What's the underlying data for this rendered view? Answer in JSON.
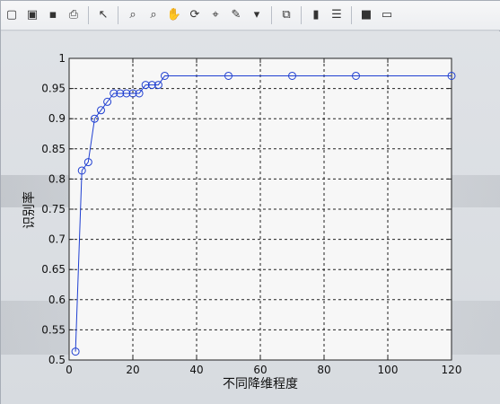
{
  "toolbar": {
    "items": [
      {
        "name": "new-figure-icon",
        "glyph": "▢"
      },
      {
        "name": "open-file-icon",
        "glyph": "▣"
      },
      {
        "name": "save-icon",
        "glyph": "▪"
      },
      {
        "name": "print-icon",
        "glyph": "⎙"
      },
      {
        "name": "pointer-icon",
        "glyph": "↖"
      },
      {
        "name": "zoom-in-icon",
        "glyph": "⌕"
      },
      {
        "name": "zoom-out-icon",
        "glyph": "⌕"
      },
      {
        "name": "pan-hand-icon",
        "glyph": "✋"
      },
      {
        "name": "rotate-3d-icon",
        "glyph": "⟳"
      },
      {
        "name": "data-cursor-icon",
        "glyph": "⌖"
      },
      {
        "name": "brush-icon",
        "glyph": "✎"
      },
      {
        "name": "brush-dropdown-icon",
        "glyph": "▾"
      },
      {
        "name": "link-plot-icon",
        "glyph": "⧉"
      },
      {
        "name": "colorbar-icon",
        "glyph": "▮"
      },
      {
        "name": "legend-icon",
        "glyph": "☰"
      },
      {
        "name": "hide-plot-tools-icon",
        "glyph": "■"
      },
      {
        "name": "show-plot-tools-icon",
        "glyph": "▭"
      }
    ]
  },
  "chart_data": {
    "type": "line",
    "title": "",
    "xlabel": "不同降维程度",
    "ylabel": "识别率",
    "xlim": [
      0,
      120
    ],
    "ylim": [
      0.5,
      1.0
    ],
    "grid": true,
    "marker": "circle",
    "color": "#1f3fd1",
    "x_ticks": [
      0,
      20,
      40,
      60,
      80,
      100,
      120
    ],
    "y_ticks": [
      0.5,
      0.55,
      0.6,
      0.65,
      0.7,
      0.75,
      0.8,
      0.85,
      0.9,
      0.95,
      1
    ],
    "x_tick_labels": [
      "0",
      "20",
      "40",
      "60",
      "80",
      "100",
      "120"
    ],
    "y_tick_labels": [
      "0.5",
      "0.55",
      "0.6",
      "0.65",
      "0.7",
      "0.75",
      "0.8",
      "0.85",
      "0.9",
      "0.95",
      "1"
    ],
    "series": [
      {
        "x": [
          2,
          4,
          6,
          8,
          10,
          12,
          14,
          16,
          18,
          20,
          22,
          24,
          26,
          28,
          30,
          50,
          70,
          90,
          120
        ],
        "values": [
          0.514,
          0.814,
          0.828,
          0.9,
          0.914,
          0.928,
          0.942,
          0.942,
          0.942,
          0.942,
          0.942,
          0.956,
          0.956,
          0.956,
          0.971,
          0.971,
          0.971,
          0.971,
          0.971
        ]
      }
    ]
  }
}
